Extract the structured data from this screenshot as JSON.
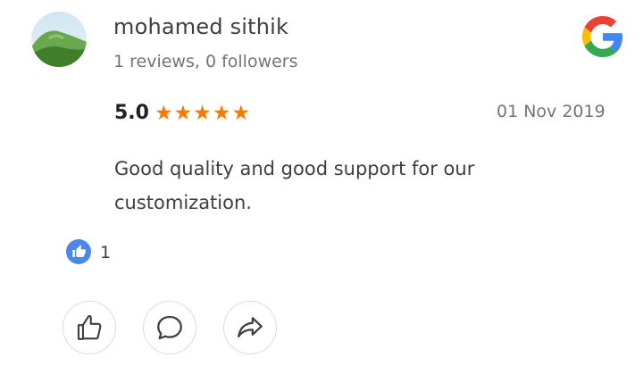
{
  "reviewer": {
    "name": "mohamed sithik",
    "meta": "1 reviews, 0 followers"
  },
  "review": {
    "rating": "5.0",
    "stars": 5,
    "date": "01 Nov 2019",
    "text": "Good quality and good support for our customization."
  },
  "likes": {
    "count": "1"
  },
  "icons": {
    "source": "google-g-logo",
    "like_badge": "thumbs-up-icon",
    "actions": [
      "thumbs-up-icon",
      "comment-icon",
      "share-icon"
    ]
  },
  "colors": {
    "star": "#f57c00",
    "like_badge": "#4a88e8"
  }
}
